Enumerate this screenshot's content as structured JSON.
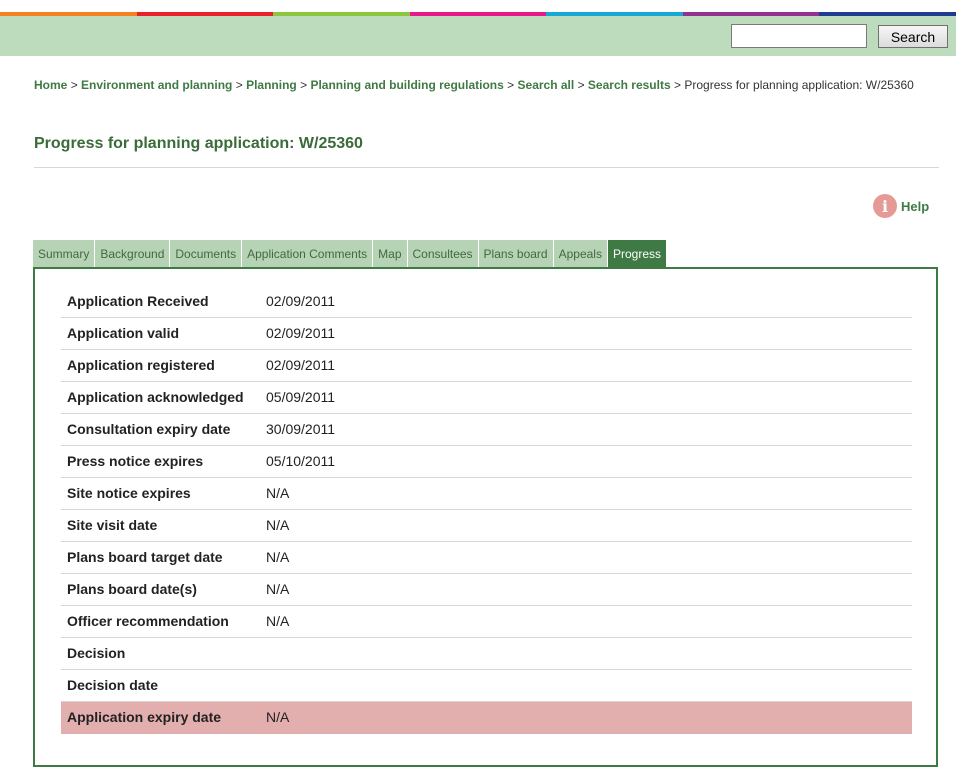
{
  "colors": {
    "topbar_segments": [
      "#f58220",
      "#e8202a",
      "#8dc63f",
      "#e8178a",
      "#17a8d4",
      "#94318f",
      "#1d3c8f"
    ],
    "band": "#bcdcbd",
    "accent_green": "#3f7a44",
    "highlight_row": "#e3aeae"
  },
  "search": {
    "value": "",
    "placeholder": "",
    "button_label": "Search"
  },
  "breadcrumb": {
    "items": [
      "Home",
      "Environment and planning",
      "Planning",
      "Planning and building regulations",
      "Search all",
      "Search results"
    ],
    "separator": ">",
    "current": "Progress for planning application: W/25360"
  },
  "page_title": "Progress for planning application: W/25360",
  "help": {
    "icon": "info-icon",
    "glyph": "i",
    "label": "Help"
  },
  "tabs": [
    {
      "label": "Summary",
      "active": false
    },
    {
      "label": "Background",
      "active": false
    },
    {
      "label": "Documents",
      "active": false
    },
    {
      "label": "Application Comments",
      "active": false
    },
    {
      "label": "Map",
      "active": false
    },
    {
      "label": "Consultees",
      "active": false
    },
    {
      "label": "Plans board",
      "active": false
    },
    {
      "label": "Appeals",
      "active": false
    },
    {
      "label": "Progress",
      "active": true
    }
  ],
  "progress": [
    {
      "label": "Application Received",
      "value": "02/09/2011"
    },
    {
      "label": "Application valid",
      "value": "02/09/2011"
    },
    {
      "label": "Application registered",
      "value": "02/09/2011"
    },
    {
      "label": "Application acknowledged",
      "value": "05/09/2011"
    },
    {
      "label": "Consultation expiry date",
      "value": "30/09/2011"
    },
    {
      "label": "Press notice expires",
      "value": "05/10/2011"
    },
    {
      "label": "Site notice expires",
      "value": "N/A"
    },
    {
      "label": "Site visit date",
      "value": "N/A"
    },
    {
      "label": "Plans board target date",
      "value": "N/A"
    },
    {
      "label": "Plans board date(s)",
      "value": "N/A"
    },
    {
      "label": "Officer recommendation",
      "value": "N/A"
    },
    {
      "label": "Decision",
      "value": ""
    },
    {
      "label": "Decision date",
      "value": ""
    },
    {
      "label": "Application expiry date",
      "value": "N/A",
      "highlight": true
    }
  ]
}
